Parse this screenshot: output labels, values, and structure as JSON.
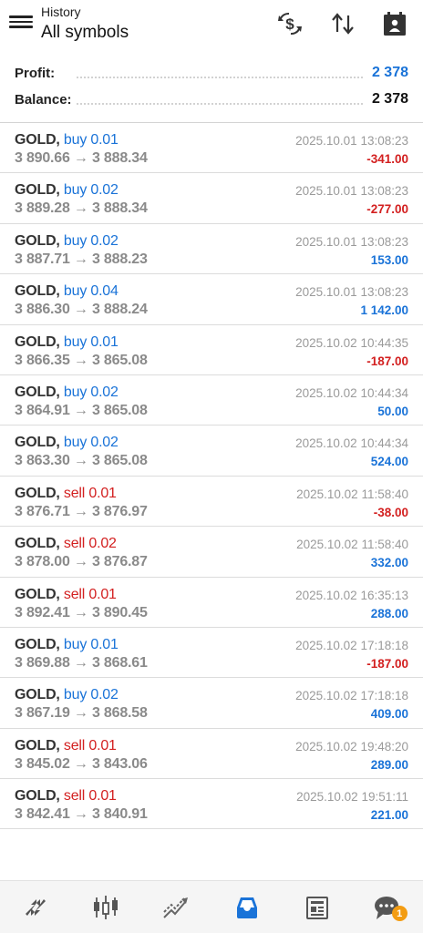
{
  "header": {
    "subtitle": "History",
    "title": "All symbols",
    "icons": [
      "menu-icon",
      "currency-exchange-icon",
      "sort-icon",
      "calendar-icon"
    ]
  },
  "summary": {
    "profit_label": "Profit:",
    "profit_value": "2 378",
    "balance_label": "Balance:",
    "balance_value": "2 378"
  },
  "colors": {
    "buy": "#1a73d8",
    "sell": "#d32020",
    "positive": "#1a73d8",
    "negative": "#d32020",
    "badge": "#f39c12"
  },
  "deals": [
    {
      "symbol": "GOLD,",
      "side": "buy",
      "side_label": "buy 0.01",
      "prices": "3 890.66 → 3 888.34",
      "time": "2025.10.01 13:08:23",
      "profit": "-341.00"
    },
    {
      "symbol": "GOLD,",
      "side": "buy",
      "side_label": "buy 0.02",
      "prices": "3 889.28 → 3 888.34",
      "time": "2025.10.01 13:08:23",
      "profit": "-277.00"
    },
    {
      "symbol": "GOLD,",
      "side": "buy",
      "side_label": "buy 0.02",
      "prices": "3 887.71 → 3 888.23",
      "time": "2025.10.01 13:08:23",
      "profit": "153.00"
    },
    {
      "symbol": "GOLD,",
      "side": "buy",
      "side_label": "buy 0.04",
      "prices": "3 886.30 → 3 888.24",
      "time": "2025.10.01 13:08:23",
      "profit": "1 142.00"
    },
    {
      "symbol": "GOLD,",
      "side": "buy",
      "side_label": "buy 0.01",
      "prices": "3 866.35 → 3 865.08",
      "time": "2025.10.02 10:44:35",
      "profit": "-187.00"
    },
    {
      "symbol": "GOLD,",
      "side": "buy",
      "side_label": "buy 0.02",
      "prices": "3 864.91 → 3 865.08",
      "time": "2025.10.02 10:44:34",
      "profit": "50.00"
    },
    {
      "symbol": "GOLD,",
      "side": "buy",
      "side_label": "buy 0.02",
      "prices": "3 863.30 → 3 865.08",
      "time": "2025.10.02 10:44:34",
      "profit": "524.00"
    },
    {
      "symbol": "GOLD,",
      "side": "sell",
      "side_label": "sell 0.01",
      "prices": "3 876.71 → 3 876.97",
      "time": "2025.10.02 11:58:40",
      "profit": "-38.00"
    },
    {
      "symbol": "GOLD,",
      "side": "sell",
      "side_label": "sell 0.02",
      "prices": "3 878.00 → 3 876.87",
      "time": "2025.10.02 11:58:40",
      "profit": "332.00"
    },
    {
      "symbol": "GOLD,",
      "side": "sell",
      "side_label": "sell 0.01",
      "prices": "3 892.41 → 3 890.45",
      "time": "2025.10.02 16:35:13",
      "profit": "288.00"
    },
    {
      "symbol": "GOLD,",
      "side": "buy",
      "side_label": "buy 0.01",
      "prices": "3 869.88 → 3 868.61",
      "time": "2025.10.02 17:18:18",
      "profit": "-187.00"
    },
    {
      "symbol": "GOLD,",
      "side": "buy",
      "side_label": "buy 0.02",
      "prices": "3 867.19 → 3 868.58",
      "time": "2025.10.02 17:18:18",
      "profit": "409.00"
    },
    {
      "symbol": "GOLD,",
      "side": "sell",
      "side_label": "sell 0.01",
      "prices": "3 845.02 → 3 843.06",
      "time": "2025.10.02 19:48:20",
      "profit": "289.00"
    },
    {
      "symbol": "GOLD,",
      "side": "sell",
      "side_label": "sell 0.01",
      "prices": "3 842.41 → 3 840.91",
      "time": "2025.10.02 19:51:11",
      "profit": "221.00"
    }
  ],
  "bottom_nav": {
    "items": [
      "quotes-icon",
      "chart-icon",
      "trade-icon",
      "history-icon",
      "news-icon",
      "messages-icon"
    ],
    "active": "history-icon",
    "messages_badge": "1"
  }
}
